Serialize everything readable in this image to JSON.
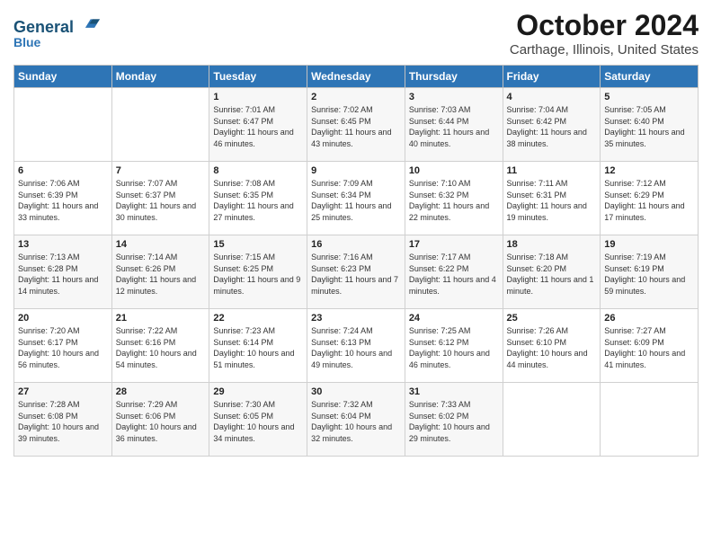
{
  "logo": {
    "line1": "General",
    "line2": "Blue"
  },
  "title": "October 2024",
  "subtitle": "Carthage, Illinois, United States",
  "days_of_week": [
    "Sunday",
    "Monday",
    "Tuesday",
    "Wednesday",
    "Thursday",
    "Friday",
    "Saturday"
  ],
  "weeks": [
    [
      {
        "day": null
      },
      {
        "day": null
      },
      {
        "day": 1,
        "sunrise": "7:01 AM",
        "sunset": "6:47 PM",
        "daylight": "11 hours and 46 minutes."
      },
      {
        "day": 2,
        "sunrise": "7:02 AM",
        "sunset": "6:45 PM",
        "daylight": "11 hours and 43 minutes."
      },
      {
        "day": 3,
        "sunrise": "7:03 AM",
        "sunset": "6:44 PM",
        "daylight": "11 hours and 40 minutes."
      },
      {
        "day": 4,
        "sunrise": "7:04 AM",
        "sunset": "6:42 PM",
        "daylight": "11 hours and 38 minutes."
      },
      {
        "day": 5,
        "sunrise": "7:05 AM",
        "sunset": "6:40 PM",
        "daylight": "11 hours and 35 minutes."
      }
    ],
    [
      {
        "day": 6,
        "sunrise": "7:06 AM",
        "sunset": "6:39 PM",
        "daylight": "11 hours and 33 minutes."
      },
      {
        "day": 7,
        "sunrise": "7:07 AM",
        "sunset": "6:37 PM",
        "daylight": "11 hours and 30 minutes."
      },
      {
        "day": 8,
        "sunrise": "7:08 AM",
        "sunset": "6:35 PM",
        "daylight": "11 hours and 27 minutes."
      },
      {
        "day": 9,
        "sunrise": "7:09 AM",
        "sunset": "6:34 PM",
        "daylight": "11 hours and 25 minutes."
      },
      {
        "day": 10,
        "sunrise": "7:10 AM",
        "sunset": "6:32 PM",
        "daylight": "11 hours and 22 minutes."
      },
      {
        "day": 11,
        "sunrise": "7:11 AM",
        "sunset": "6:31 PM",
        "daylight": "11 hours and 19 minutes."
      },
      {
        "day": 12,
        "sunrise": "7:12 AM",
        "sunset": "6:29 PM",
        "daylight": "11 hours and 17 minutes."
      }
    ],
    [
      {
        "day": 13,
        "sunrise": "7:13 AM",
        "sunset": "6:28 PM",
        "daylight": "11 hours and 14 minutes."
      },
      {
        "day": 14,
        "sunrise": "7:14 AM",
        "sunset": "6:26 PM",
        "daylight": "11 hours and 12 minutes."
      },
      {
        "day": 15,
        "sunrise": "7:15 AM",
        "sunset": "6:25 PM",
        "daylight": "11 hours and 9 minutes."
      },
      {
        "day": 16,
        "sunrise": "7:16 AM",
        "sunset": "6:23 PM",
        "daylight": "11 hours and 7 minutes."
      },
      {
        "day": 17,
        "sunrise": "7:17 AM",
        "sunset": "6:22 PM",
        "daylight": "11 hours and 4 minutes."
      },
      {
        "day": 18,
        "sunrise": "7:18 AM",
        "sunset": "6:20 PM",
        "daylight": "11 hours and 1 minute."
      },
      {
        "day": 19,
        "sunrise": "7:19 AM",
        "sunset": "6:19 PM",
        "daylight": "10 hours and 59 minutes."
      }
    ],
    [
      {
        "day": 20,
        "sunrise": "7:20 AM",
        "sunset": "6:17 PM",
        "daylight": "10 hours and 56 minutes."
      },
      {
        "day": 21,
        "sunrise": "7:22 AM",
        "sunset": "6:16 PM",
        "daylight": "10 hours and 54 minutes."
      },
      {
        "day": 22,
        "sunrise": "7:23 AM",
        "sunset": "6:14 PM",
        "daylight": "10 hours and 51 minutes."
      },
      {
        "day": 23,
        "sunrise": "7:24 AM",
        "sunset": "6:13 PM",
        "daylight": "10 hours and 49 minutes."
      },
      {
        "day": 24,
        "sunrise": "7:25 AM",
        "sunset": "6:12 PM",
        "daylight": "10 hours and 46 minutes."
      },
      {
        "day": 25,
        "sunrise": "7:26 AM",
        "sunset": "6:10 PM",
        "daylight": "10 hours and 44 minutes."
      },
      {
        "day": 26,
        "sunrise": "7:27 AM",
        "sunset": "6:09 PM",
        "daylight": "10 hours and 41 minutes."
      }
    ],
    [
      {
        "day": 27,
        "sunrise": "7:28 AM",
        "sunset": "6:08 PM",
        "daylight": "10 hours and 39 minutes."
      },
      {
        "day": 28,
        "sunrise": "7:29 AM",
        "sunset": "6:06 PM",
        "daylight": "10 hours and 36 minutes."
      },
      {
        "day": 29,
        "sunrise": "7:30 AM",
        "sunset": "6:05 PM",
        "daylight": "10 hours and 34 minutes."
      },
      {
        "day": 30,
        "sunrise": "7:32 AM",
        "sunset": "6:04 PM",
        "daylight": "10 hours and 32 minutes."
      },
      {
        "day": 31,
        "sunrise": "7:33 AM",
        "sunset": "6:02 PM",
        "daylight": "10 hours and 29 minutes."
      },
      {
        "day": null
      },
      {
        "day": null
      }
    ]
  ],
  "labels": {
    "sunrise": "Sunrise:",
    "sunset": "Sunset:",
    "daylight": "Daylight:"
  },
  "colors": {
    "header_bg": "#2e75b6",
    "header_text": "#ffffff",
    "accent": "#1a5276"
  }
}
